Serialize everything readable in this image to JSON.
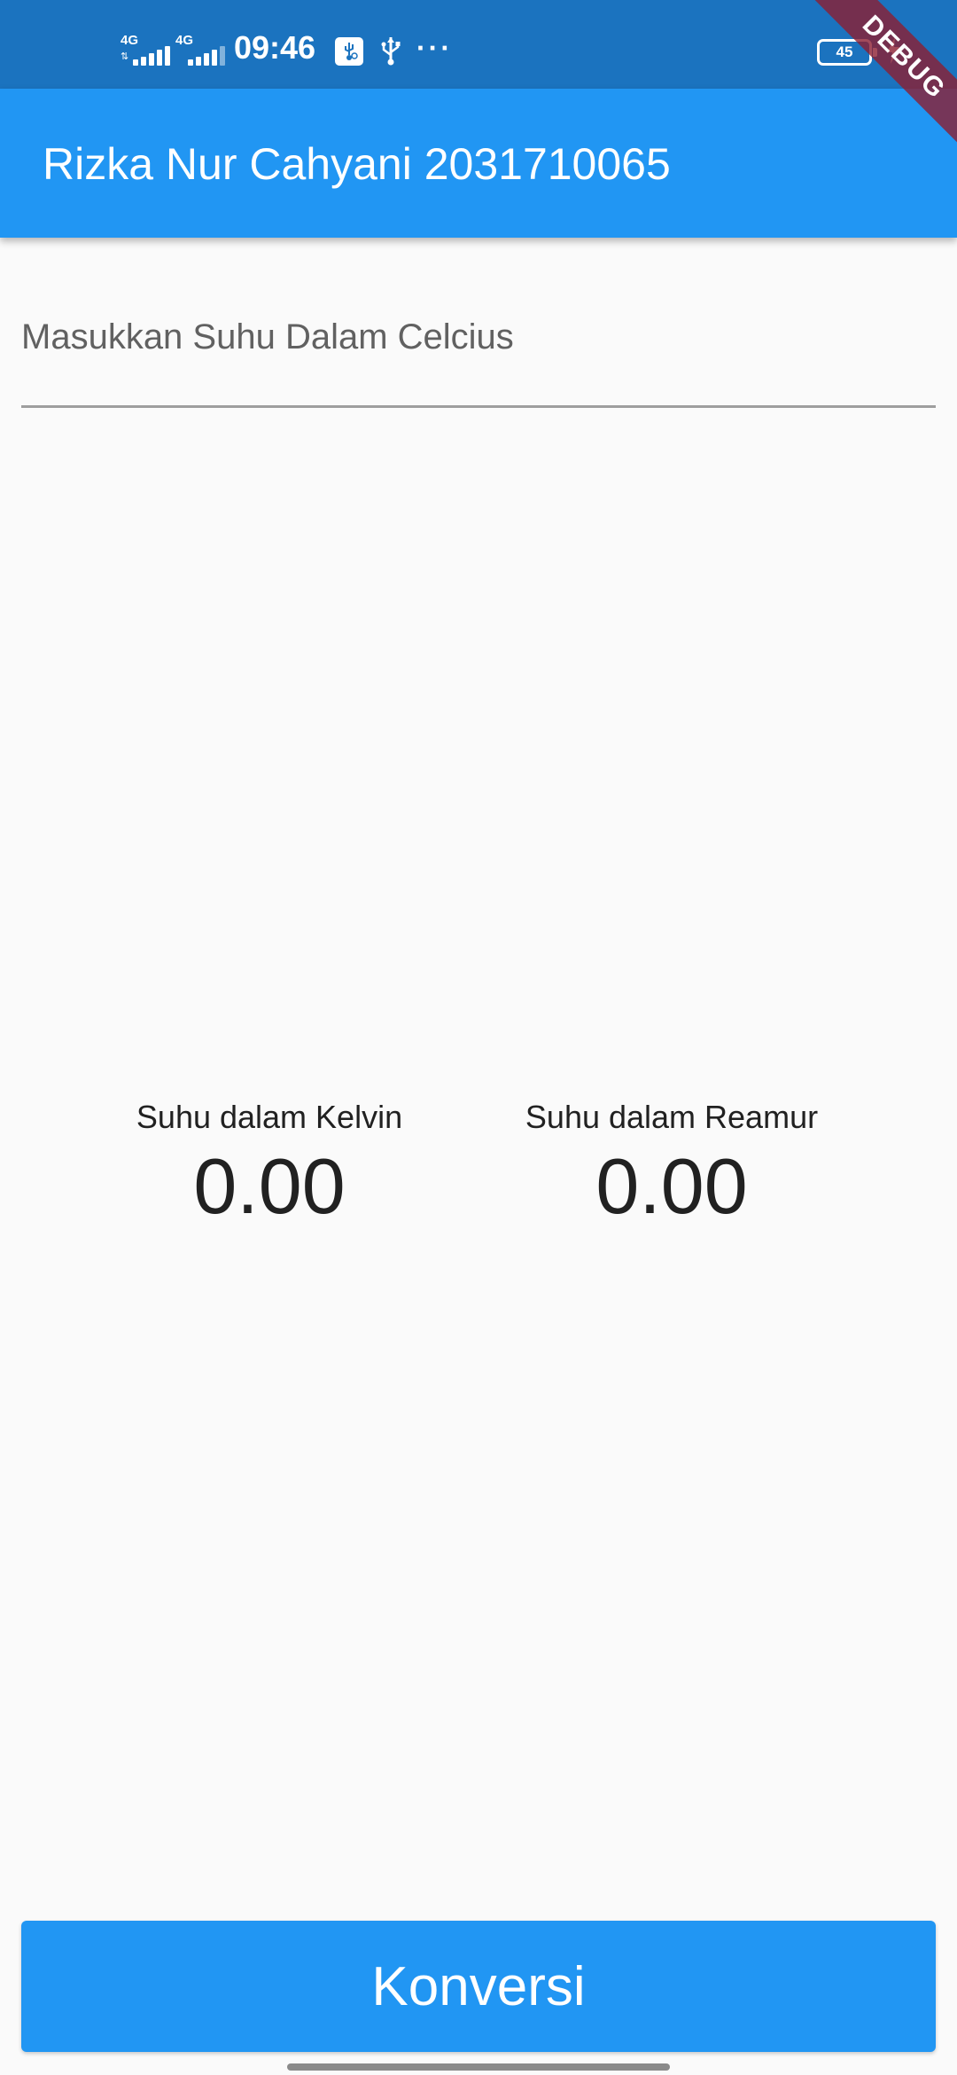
{
  "status_bar": {
    "sim1_network": "4G",
    "sim2_network": "4G",
    "time": "09:46",
    "battery_level": "45",
    "overflow": "···"
  },
  "debug_banner": "DEBUG",
  "app_bar": {
    "title": "Rizka Nur Cahyani 2031710065"
  },
  "celcius_input": {
    "placeholder": "Masukkan Suhu Dalam Celcius",
    "value": ""
  },
  "results": {
    "kelvin": {
      "label": "Suhu dalam Kelvin",
      "value": "0.00"
    },
    "reamur": {
      "label": "Suhu dalam Reamur",
      "value": "0.00"
    }
  },
  "convert_button": {
    "label": "Konversi"
  },
  "colors": {
    "primary": "#2196f3",
    "status_bar": "#1b73bf",
    "background": "#fafafa"
  }
}
